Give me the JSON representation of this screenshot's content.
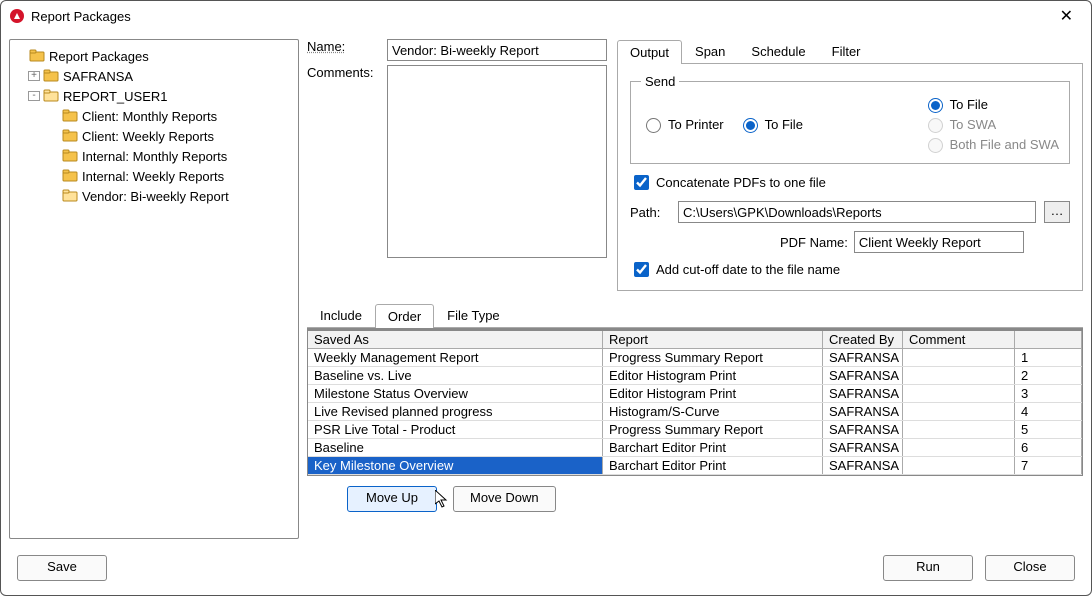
{
  "window": {
    "title": "Report Packages"
  },
  "tree": {
    "root": "Report Packages",
    "nodes": [
      {
        "label": "SAFRANSA",
        "expand": "+"
      },
      {
        "label": "REPORT_USER1",
        "expand": "-"
      }
    ],
    "children": [
      "Client: Monthly Reports",
      "Client: Weekly Reports",
      "Internal: Monthly Reports",
      "Internal: Weekly Reports",
      "Vendor: Bi-weekly Report"
    ]
  },
  "form": {
    "name_label": "Name:",
    "name_value": "Vendor: Bi-weekly Report",
    "comments_label": "Comments:",
    "comments_value": ""
  },
  "tabs_top": {
    "output": "Output",
    "span": "Span",
    "schedule": "Schedule",
    "filter": "Filter"
  },
  "output": {
    "send_legend": "Send",
    "to_printer": "To Printer",
    "to_file": "To File",
    "to_swa": "To SWA",
    "both": "Both File and SWA",
    "concat": "Concatenate PDFs to one file",
    "path_label": "Path:",
    "path_value": "C:\\Users\\GPK\\Downloads\\Reports",
    "pdfname_label": "PDF Name:",
    "pdfname_value": "Client Weekly Report",
    "cutoff": "Add cut-off date to the file name"
  },
  "tabs_lower": {
    "include": "Include",
    "order": "Order",
    "filetype": "File Type"
  },
  "grid": {
    "headers": {
      "saved": "Saved As",
      "report": "Report",
      "created": "Created By",
      "comment": "Comment",
      "n": ""
    },
    "rows": [
      {
        "saved": "Weekly Management Report",
        "report": "Progress Summary Report",
        "created": "SAFRANSA",
        "comment": "",
        "n": "1"
      },
      {
        "saved": "Baseline vs. Live",
        "report": "Editor Histogram Print",
        "created": "SAFRANSA",
        "comment": "",
        "n": "2"
      },
      {
        "saved": "Milestone Status Overview",
        "report": "Editor Histogram Print",
        "created": "SAFRANSA",
        "comment": "",
        "n": "3"
      },
      {
        "saved": "Live Revised planned progress",
        "report": "Histogram/S-Curve",
        "created": "SAFRANSA",
        "comment": "",
        "n": "4"
      },
      {
        "saved": "PSR Live Total - Product",
        "report": "Progress Summary Report",
        "created": "SAFRANSA",
        "comment": "",
        "n": "5"
      },
      {
        "saved": "Baseline",
        "report": "Barchart Editor Print",
        "created": "SAFRANSA",
        "comment": "",
        "n": "6"
      },
      {
        "saved": "Key Milestone Overview",
        "report": "Barchart Editor Print",
        "created": "SAFRANSA",
        "comment": "",
        "n": "7"
      }
    ],
    "selected_index": 6
  },
  "buttons": {
    "moveup": "Move Up",
    "movedown": "Move Down",
    "save": "Save",
    "run": "Run",
    "close": "Close"
  }
}
